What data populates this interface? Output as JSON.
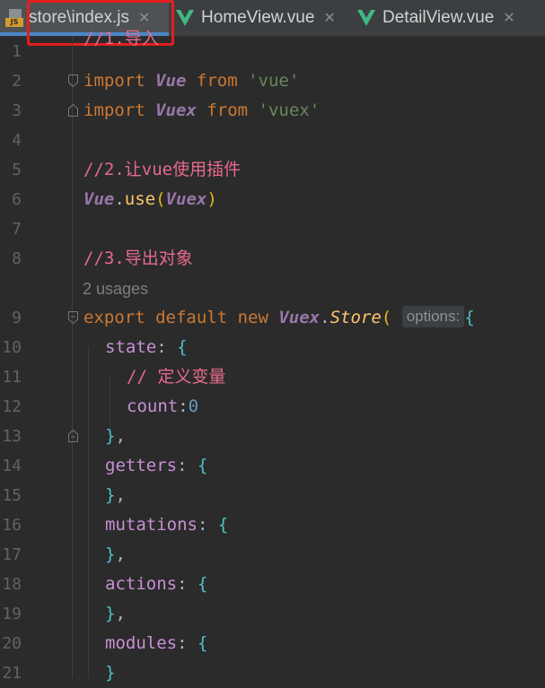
{
  "tabs": [
    {
      "label": "store\\index.js",
      "icon": "js-file-icon",
      "icon_text": "JS",
      "active": true
    },
    {
      "label": "HomeView.vue",
      "icon": "vue-file-icon",
      "active": false
    },
    {
      "label": "DetailView.vue",
      "icon": "vue-file-icon",
      "active": false
    }
  ],
  "colors": {
    "accent": "#4a88c7",
    "highlight": "#e51e1e",
    "background": "#2b2b2b",
    "vue_green": "#41b883"
  },
  "editor": {
    "usages_hint": "2 usages",
    "inlay_hint": "options:",
    "lines": [
      {
        "num": "1",
        "text": "//1.导入"
      },
      {
        "num": "2",
        "text": "import Vue from 'vue'"
      },
      {
        "num": "3",
        "text": "import Vuex from 'vuex'"
      },
      {
        "num": "4",
        "text": ""
      },
      {
        "num": "5",
        "text": "//2.让vue使用插件"
      },
      {
        "num": "6",
        "text": "Vue.use(Vuex)"
      },
      {
        "num": "7",
        "text": ""
      },
      {
        "num": "8",
        "text": "//3.导出对象"
      },
      {
        "num": "9",
        "text": "export default new Vuex.Store( options: {"
      },
      {
        "num": "10",
        "text": "state: {"
      },
      {
        "num": "11",
        "text": "// 定义变量"
      },
      {
        "num": "12",
        "text": "count:0"
      },
      {
        "num": "13",
        "text": "},"
      },
      {
        "num": "14",
        "text": "getters: {"
      },
      {
        "num": "15",
        "text": "},"
      },
      {
        "num": "16",
        "text": "mutations: {"
      },
      {
        "num": "17",
        "text": "},"
      },
      {
        "num": "18",
        "text": "actions: {"
      },
      {
        "num": "19",
        "text": "},"
      },
      {
        "num": "20",
        "text": "modules: {"
      },
      {
        "num": "21",
        "text": "}"
      }
    ]
  }
}
